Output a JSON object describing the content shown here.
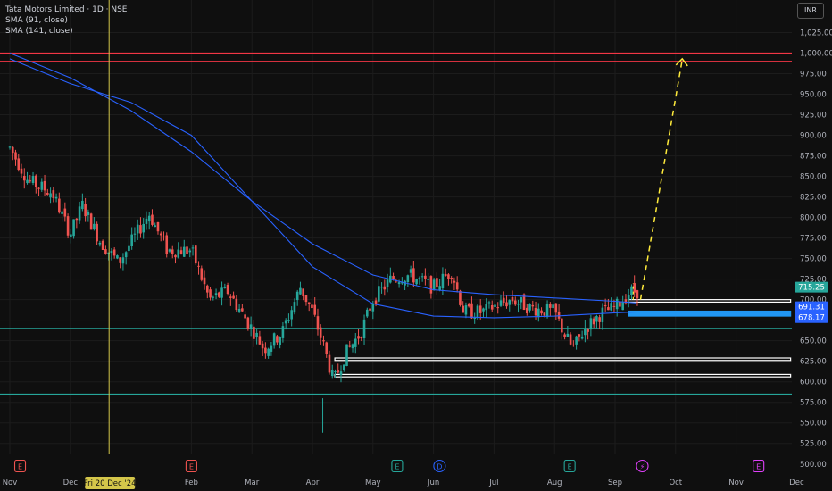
{
  "legend": {
    "title": "Tata Motors Limited · 1D · NSE",
    "sma1": "SMA (91, close)",
    "sma2": "SMA (141, close)"
  },
  "currency": "INR",
  "colors": {
    "background": "#0f0f0f",
    "grid": "#1c1c1c",
    "up": "#26a69a",
    "down": "#ef5350",
    "sma": "#2962ff",
    "resistance": "#f23645",
    "support": "#26a69a",
    "zone": "#ffffff",
    "zoneBlue": "#2196f3",
    "projection": "#ffeb3b",
    "crosshair": "#d4c64a"
  },
  "chart_data": {
    "type": "candlestick",
    "title": "Tata Motors Limited · 1D · NSE",
    "ylim": [
      490,
      1040
    ],
    "y_ticks": [
      1025,
      1000,
      975,
      950,
      925,
      900,
      875,
      850,
      825,
      800,
      775,
      750,
      725,
      700,
      675,
      650,
      625,
      600,
      575,
      550,
      525,
      500
    ],
    "x_ticks": [
      {
        "label": "Nov",
        "x": 0
      },
      {
        "label": "Dec",
        "x": 1
      },
      {
        "label": "Feb",
        "x": 3
      },
      {
        "label": "Mar",
        "x": 4
      },
      {
        "label": "Apr",
        "x": 5
      },
      {
        "label": "May",
        "x": 6
      },
      {
        "label": "Jun",
        "x": 7
      },
      {
        "label": "Jul",
        "x": 8
      },
      {
        "label": "Aug",
        "x": 9
      },
      {
        "label": "Sep",
        "x": 10
      },
      {
        "label": "Oct",
        "x": 11
      },
      {
        "label": "Nov",
        "x": 12
      },
      {
        "label": "Dec",
        "x": 13
      }
    ],
    "crosshair": {
      "x": 1.64,
      "label": "Fri 20 Dec '24"
    },
    "price_labels": [
      {
        "value": 715.25,
        "text": "715.25",
        "color": "#26a69a"
      },
      {
        "value": 691.31,
        "text": "691.31",
        "color": "#2962ff"
      },
      {
        "value": 678.17,
        "text": "678.17",
        "color": "#2962ff"
      }
    ],
    "horizontal_lines": [
      {
        "value": 1000,
        "color": "#f23645"
      },
      {
        "value": 990,
        "color": "#f23645"
      },
      {
        "value": 665,
        "color": "#26a69a"
      },
      {
        "value": 585,
        "color": "#26a69a"
      }
    ],
    "zones": [
      {
        "x1": 10.22,
        "x2": 12.9,
        "y1": 700,
        "y2": 697,
        "color": "#ffffff"
      },
      {
        "x1": 10.22,
        "x2": 12.9,
        "y1": 686,
        "y2": 680,
        "color": "#2196f3"
      },
      {
        "x1": 5.37,
        "x2": 12.9,
        "y1": 629,
        "y2": 626,
        "color": "#ffffff"
      },
      {
        "x1": 5.37,
        "x2": 12.9,
        "y1": 609,
        "y2": 606,
        "color": "#ffffff"
      }
    ],
    "projection": {
      "from": [
        10.42,
        700
      ],
      "to": [
        11.11,
        992
      ]
    },
    "event_markers": [
      {
        "x": 0.17,
        "label": "E",
        "color": "#ef5350"
      },
      {
        "x": 3.0,
        "label": "E",
        "color": "#ef5350"
      },
      {
        "x": 6.4,
        "label": "E",
        "color": "#26a69a"
      },
      {
        "x": 7.1,
        "label": "D",
        "color": "#2962ff"
      },
      {
        "x": 9.25,
        "label": "E",
        "color": "#26a69a"
      },
      {
        "x": 10.45,
        "label": "⚡",
        "color": "#e040fb"
      },
      {
        "x": 12.37,
        "label": "E",
        "color": "#e040fb"
      }
    ],
    "sma_series": [
      {
        "name": "SMA (91, close)",
        "points": [
          [
            0,
            1000
          ],
          [
            1,
            970
          ],
          [
            2,
            930
          ],
          [
            3,
            880
          ],
          [
            4,
            820
          ],
          [
            5,
            768
          ],
          [
            6,
            730
          ],
          [
            7,
            712
          ],
          [
            8,
            706
          ],
          [
            9,
            702
          ],
          [
            10,
            698
          ],
          [
            10.35,
            696
          ]
        ]
      },
      {
        "name": "SMA (141, close)",
        "points": [
          [
            0,
            993
          ],
          [
            1,
            963
          ],
          [
            2,
            940
          ],
          [
            3,
            900
          ],
          [
            4,
            820
          ],
          [
            5,
            740
          ],
          [
            6,
            695
          ],
          [
            7,
            680
          ],
          [
            8,
            678
          ],
          [
            9,
            680
          ],
          [
            10,
            684
          ],
          [
            10.35,
            685
          ]
        ]
      }
    ],
    "anchors": [
      [
        0,
        885
      ],
      [
        0.3,
        845
      ],
      [
        0.7,
        830
      ],
      [
        1.0,
        780
      ],
      [
        1.2,
        815
      ],
      [
        1.5,
        770
      ],
      [
        1.8,
        745
      ],
      [
        2.3,
        805
      ],
      [
        2.6,
        760
      ],
      [
        3.0,
        760
      ],
      [
        3.3,
        700
      ],
      [
        3.6,
        710
      ],
      [
        4.0,
        665
      ],
      [
        4.2,
        640
      ],
      [
        4.5,
        660
      ],
      [
        4.8,
        715
      ],
      [
        5.0,
        685
      ],
      [
        5.18,
        645
      ],
      [
        5.35,
        600
      ],
      [
        5.55,
        635
      ],
      [
        5.8,
        660
      ],
      [
        6.0,
        700
      ],
      [
        6.3,
        725
      ],
      [
        6.6,
        730
      ],
      [
        7.0,
        715
      ],
      [
        7.3,
        735
      ],
      [
        7.5,
        685
      ],
      [
        7.8,
        685
      ],
      [
        8.0,
        692
      ],
      [
        8.3,
        700
      ],
      [
        8.6,
        690
      ],
      [
        9.0,
        685
      ],
      [
        9.15,
        660
      ],
      [
        9.3,
        640
      ],
      [
        9.5,
        665
      ],
      [
        9.8,
        685
      ],
      [
        10.0,
        690
      ],
      [
        10.25,
        710
      ],
      [
        10.4,
        710
      ]
    ]
  }
}
